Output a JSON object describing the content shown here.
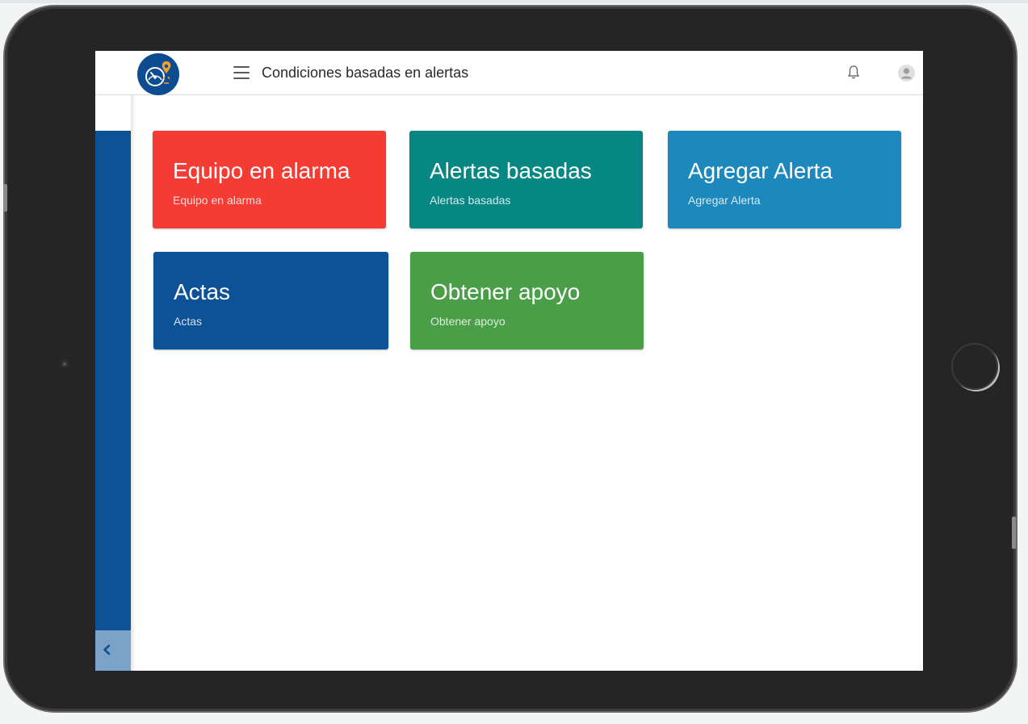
{
  "header": {
    "title": "Condiciones basadas en alertas",
    "logo_icon": "gauge-location-logo",
    "menu_icon": "hamburger-menu-icon",
    "bell_icon": "bell-icon",
    "avatar_icon": "user-avatar-icon"
  },
  "sidebar": {
    "color": "#0d5296",
    "toggle_icon": "chevron-left-icon"
  },
  "cards": [
    {
      "title": "Equipo en alarma",
      "subtitle": "Equipo en alarma",
      "color": "#f43c34"
    },
    {
      "title": "Alertas basadas",
      "subtitle": "Alertas basadas",
      "color": "#078783"
    },
    {
      "title": "Agregar Alerta",
      "subtitle": "Agregar Alerta",
      "color": "#1c88bb"
    },
    {
      "title": "Actas",
      "subtitle": "Actas",
      "color": "#0d5296"
    },
    {
      "title": "Obtener apoyo",
      "subtitle": "Obtener apoyo",
      "color": "#4a9e47"
    }
  ]
}
